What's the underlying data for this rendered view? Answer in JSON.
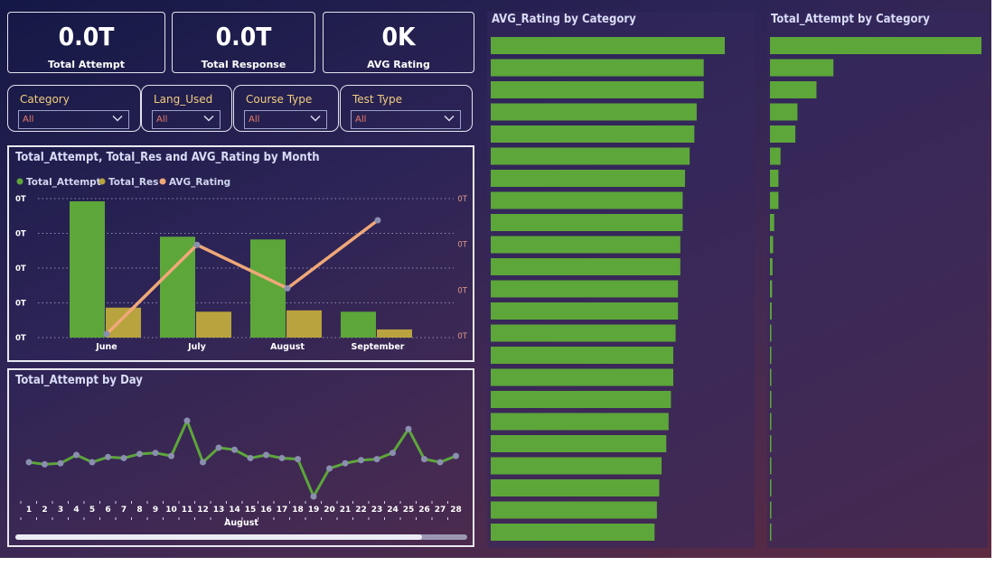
{
  "kpis": [
    {
      "value": "0.0T",
      "label": "Total Attempt"
    },
    {
      "value": "0.0T",
      "label": "Total Response"
    },
    {
      "value": "0K",
      "label": "AVG Rating"
    }
  ],
  "slicers": [
    {
      "title": "Category",
      "value": "All"
    },
    {
      "title": "Lang_Used",
      "value": "All"
    },
    {
      "title": "Course Type",
      "value": "All"
    },
    {
      "title": "Test Type",
      "value": "All"
    }
  ],
  "colors": {
    "green": "#5da63a",
    "gold": "#b8a33e",
    "orange": "#f0a878",
    "marker": "#8a8fb0"
  },
  "chart_data": [
    {
      "type": "bar",
      "title": "Total_Attempt, Total_Res and AVG_Rating by Month",
      "categories": [
        "June",
        "July",
        "August",
        "September"
      ],
      "series": [
        {
          "name": "Total_Attempt",
          "kind": "bar",
          "values": [
            1.0,
            0.74,
            0.72,
            0.19
          ]
        },
        {
          "name": "Total_Res",
          "kind": "bar",
          "values": [
            0.22,
            0.19,
            0.2,
            0.06
          ]
        },
        {
          "name": "AVG_Rating",
          "kind": "line",
          "axis": "right",
          "values": [
            0.0,
            0.76,
            0.39,
            0.97
          ]
        }
      ],
      "left_ticks": [
        "0T",
        "0T",
        "0T",
        "0T",
        "0T"
      ],
      "right_ticks": [
        "0T",
        "0T",
        "0T",
        "0T"
      ],
      "legend_position": "top-left"
    },
    {
      "type": "line",
      "title": "Total_Attempt by Day",
      "x": [
        1,
        2,
        3,
        4,
        5,
        6,
        7,
        8,
        9,
        10,
        11,
        12,
        13,
        14,
        15,
        16,
        17,
        18,
        19,
        20,
        21,
        22,
        23,
        24,
        25,
        26,
        27,
        28
      ],
      "values": [
        0.48,
        0.46,
        0.47,
        0.55,
        0.48,
        0.53,
        0.52,
        0.56,
        0.57,
        0.54,
        0.88,
        0.48,
        0.62,
        0.6,
        0.52,
        0.55,
        0.52,
        0.51,
        0.15,
        0.42,
        0.47,
        0.5,
        0.51,
        0.57,
        0.8,
        0.51,
        0.48,
        0.54
      ],
      "xlabel": "August",
      "scrollbar": true
    },
    {
      "type": "bar",
      "orientation": "horizontal",
      "title": "AVG_Rating by Category",
      "values": [
        1.0,
        0.91,
        0.91,
        0.88,
        0.87,
        0.85,
        0.83,
        0.82,
        0.82,
        0.81,
        0.81,
        0.8,
        0.8,
        0.79,
        0.78,
        0.78,
        0.77,
        0.76,
        0.75,
        0.73,
        0.72,
        0.71,
        0.7
      ]
    },
    {
      "type": "bar",
      "orientation": "horizontal",
      "title": "Total_Attempt by Category",
      "values": [
        1.0,
        0.3,
        0.22,
        0.13,
        0.12,
        0.05,
        0.04,
        0.04,
        0.02,
        0.015,
        0.012,
        0.01,
        0.008,
        0.006,
        0.005,
        0.004,
        0.004,
        0.003,
        0.003,
        0.003,
        0.002,
        0.002,
        0.002
      ]
    }
  ]
}
